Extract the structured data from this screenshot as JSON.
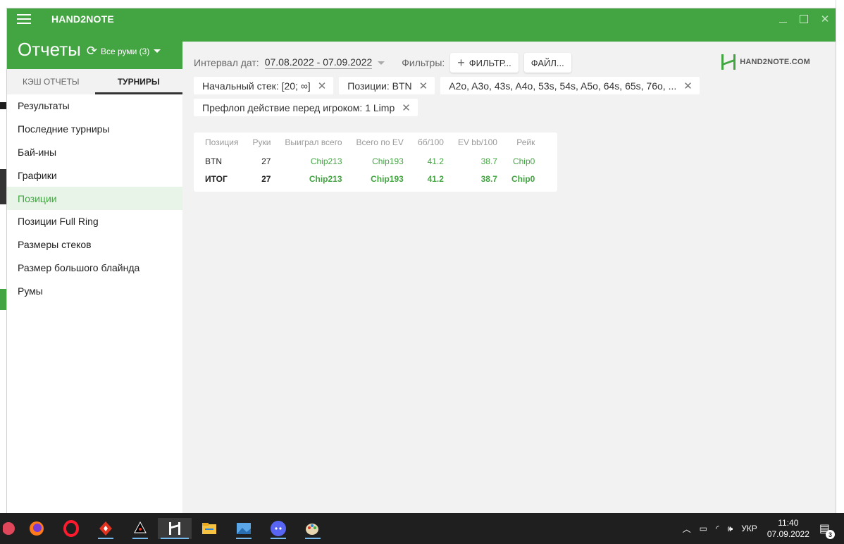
{
  "app": {
    "title": "HAND2NOTE",
    "logo_text": "HAND2NOTE.COM"
  },
  "left": {
    "title": "Отчеты",
    "rooms_label": "Все руми (3)",
    "tabs": [
      {
        "label": "КЭШ ОТЧЕТЫ",
        "active": false
      },
      {
        "label": "ТУРНИРЫ",
        "active": true
      }
    ],
    "nav": [
      {
        "label": "Результаты"
      },
      {
        "label": "Последние турниры"
      },
      {
        "label": "Бай-ины"
      },
      {
        "label": "Графики"
      },
      {
        "label": "Позиции",
        "active": true
      },
      {
        "label": "Позиции Full Ring"
      },
      {
        "label": "Размеры стеков"
      },
      {
        "label": "Размер большого блайнда"
      },
      {
        "label": "Румы"
      }
    ]
  },
  "toolbar": {
    "date_label": "Интервал дат:",
    "date_value": "07.08.2022 - 07.09.2022",
    "filters_label": "Фильтры:",
    "filter_button": "ФИЛЬТР...",
    "file_button": "ФАЙЛ..."
  },
  "chips": [
    "Начальный стек: [20; ∞]",
    "Позиции: BTN",
    "A2o, A3o, 43s, A4o, 53s, 54s, A5o, 64s, 65s, 76o, ...",
    "Префлоп действие перед игроком: 1 Limp"
  ],
  "table": {
    "headers": [
      "Позиция",
      "Руки",
      "Выиграл всего",
      "Всего по EV",
      "бб/100",
      "EV bb/100",
      "Рейк"
    ],
    "rows": [
      [
        "BTN",
        "27",
        "Chip213",
        "Chip193",
        "41.2",
        "38.7",
        "Chip0"
      ]
    ],
    "total": [
      "ИТОГ",
      "27",
      "Chip213",
      "Chip193",
      "41.2",
      "38.7",
      "Chip0"
    ]
  },
  "taskbar": {
    "language": "УКР",
    "time": "11:40",
    "date": "07.09.2022",
    "notifications": "3"
  },
  "colors": {
    "brand_green": "#43a542",
    "accent_text_green": "#43a542"
  }
}
